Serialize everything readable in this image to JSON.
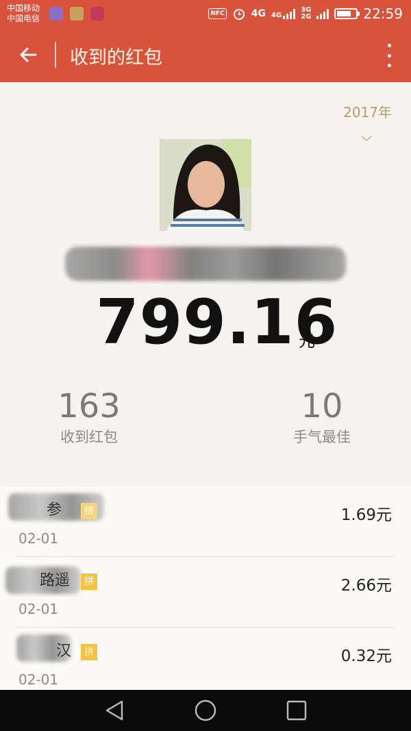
{
  "status_bar": {
    "carrier_1": "中国移动",
    "carrier_2": "中国电信",
    "nfc": "NFC",
    "net_1": "4G",
    "net_1_small": "4G",
    "net_2_small_top": "3G",
    "net_2_small_bottom": "2G",
    "time": "22:59",
    "battery_level_percent": 75
  },
  "header": {
    "title": "收到的红包",
    "back_icon": "arrow-left-icon",
    "more_icon": "more-vertical-icon"
  },
  "summary": {
    "year": "2017年",
    "total_amount": "799.16",
    "total_unit": "元",
    "stats": [
      {
        "value": "163",
        "label": "收到红包"
      },
      {
        "value": "10",
        "label": "手气最佳"
      }
    ]
  },
  "records": [
    {
      "name_visible": "参",
      "badge": "拼",
      "date": "02-01",
      "amount": "1.69元"
    },
    {
      "name_visible": "路遥",
      "badge": "拼",
      "date": "02-01",
      "amount": "2.66元"
    },
    {
      "name_visible": "汉",
      "badge": "拼",
      "date": "02-01",
      "amount": "0.32元"
    }
  ],
  "colors": {
    "accent": "#d9533c",
    "year_text": "#b59c6a",
    "badge": "#f5c242"
  }
}
